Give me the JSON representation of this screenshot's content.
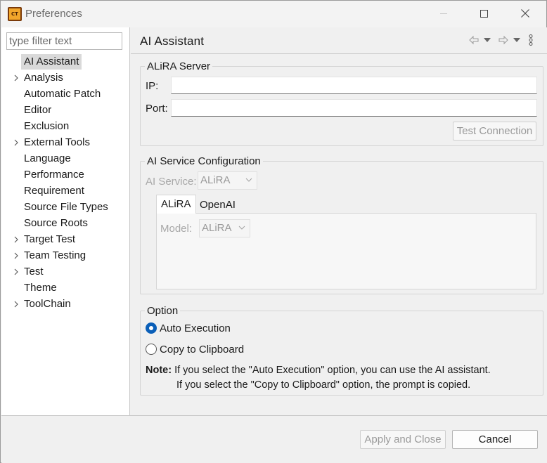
{
  "window": {
    "title": "Preferences",
    "app_icon_text": "CT"
  },
  "sidebar": {
    "filter_placeholder": "type filter text",
    "items": [
      {
        "label": "AI Assistant",
        "expandable": false,
        "selected": true
      },
      {
        "label": "Analysis",
        "expandable": true,
        "selected": false
      },
      {
        "label": "Automatic Patch",
        "expandable": false,
        "selected": false
      },
      {
        "label": "Editor",
        "expandable": false,
        "selected": false
      },
      {
        "label": "Exclusion",
        "expandable": false,
        "selected": false
      },
      {
        "label": "External Tools",
        "expandable": true,
        "selected": false
      },
      {
        "label": "Language",
        "expandable": false,
        "selected": false
      },
      {
        "label": "Performance",
        "expandable": false,
        "selected": false
      },
      {
        "label": "Requirement",
        "expandable": false,
        "selected": false
      },
      {
        "label": "Source File Types",
        "expandable": false,
        "selected": false
      },
      {
        "label": "Source Roots",
        "expandable": false,
        "selected": false
      },
      {
        "label": "Target Test",
        "expandable": true,
        "selected": false
      },
      {
        "label": "Team Testing",
        "expandable": true,
        "selected": false
      },
      {
        "label": "Test",
        "expandable": true,
        "selected": false
      },
      {
        "label": "Theme",
        "expandable": false,
        "selected": false
      },
      {
        "label": "ToolChain",
        "expandable": true,
        "selected": false
      }
    ]
  },
  "page": {
    "title": "AI Assistant",
    "server_group": {
      "legend": "ALiRA Server",
      "ip_label": "IP:",
      "ip_value": "",
      "port_label": "Port:",
      "port_value": "",
      "test_button": "Test Connection"
    },
    "service_group": {
      "legend": "AI Service Configuration",
      "service_label": "AI Service:",
      "service_value": "ALiRA",
      "tabs": [
        "ALiRA",
        "OpenAI"
      ],
      "model_label": "Model:",
      "model_value": "ALiRA"
    },
    "option_group": {
      "legend": "Option",
      "auto_execution": "Auto Execution",
      "copy_clipboard": "Copy to Clipboard",
      "selected": "auto_execution",
      "note_label": "Note:",
      "note_line1": "If you select the \"Auto Execution\" option, you can use the AI assistant.",
      "note_line2": "If you select the \"Copy to Clipboard\" option, the prompt is copied."
    }
  },
  "footer": {
    "apply_close": "Apply and Close",
    "cancel": "Cancel"
  },
  "icons": {
    "back": "back-arrow-icon",
    "forward": "forward-arrow-icon",
    "menu": "view-menu-icon"
  },
  "colors": {
    "accent": "#0a5fb8",
    "selection": "#d9d9d9"
  }
}
